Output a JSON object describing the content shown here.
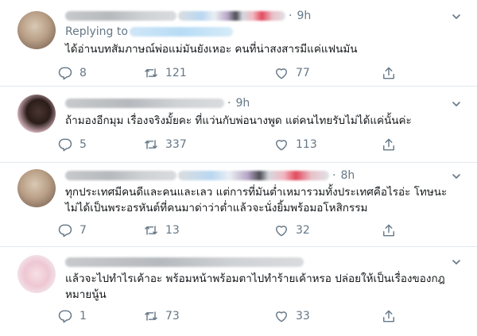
{
  "tweets": [
    {
      "time": "9h",
      "replying_label": "Replying to",
      "text": "ได้อ่านบทสัมภาษณ์พ่อแม่มันยังเหอะ คนที่น่าสงสารมีแค่แฟนมัน",
      "replies": "8",
      "retweets": "121",
      "likes": "77"
    },
    {
      "time": "9h",
      "text": "ถ้ามองอีกมุม เรื่องจริงมั้ยคะ ที่แว่นกับพ่อนางพูด แต่คนไทยรับไม่ได้แค่นั้นค่ะ",
      "replies": "5",
      "retweets": "337",
      "likes": "113"
    },
    {
      "time": "8h",
      "text_line1": "ทุกประเทศมีคนดีและคนและเลว แต่การที่มันต่ำเหมารวมทั้งประเทศคือไรอ่ะ โทษนะ",
      "text_line2": "ไม่ได้เป็นพระอรหันต์ที่คนมาด่าว่าต่ำแล้วจะนั่งยิ้มพร้อมอโหสิกรรม",
      "replies": "7",
      "retweets": "13",
      "likes": "32"
    },
    {
      "text_line1": "แล้วจะไปทำไรเค้าอะ พร้อมหน้าพร้อมตาไปทำร้ายเค้าหรอ ปล่อยให้เป็นเรื่องของกฎ",
      "text_line2": "หมายนู้น",
      "replies": "1",
      "retweets": "73",
      "likes": "33"
    }
  ],
  "icons": {
    "reply": "reply-icon",
    "retweet": "retweet-icon",
    "like": "heart-icon",
    "share": "share-icon",
    "more": "chevron-down-icon"
  },
  "colors": {
    "secondary_text": "#657786",
    "divider": "#e1e8ed"
  }
}
